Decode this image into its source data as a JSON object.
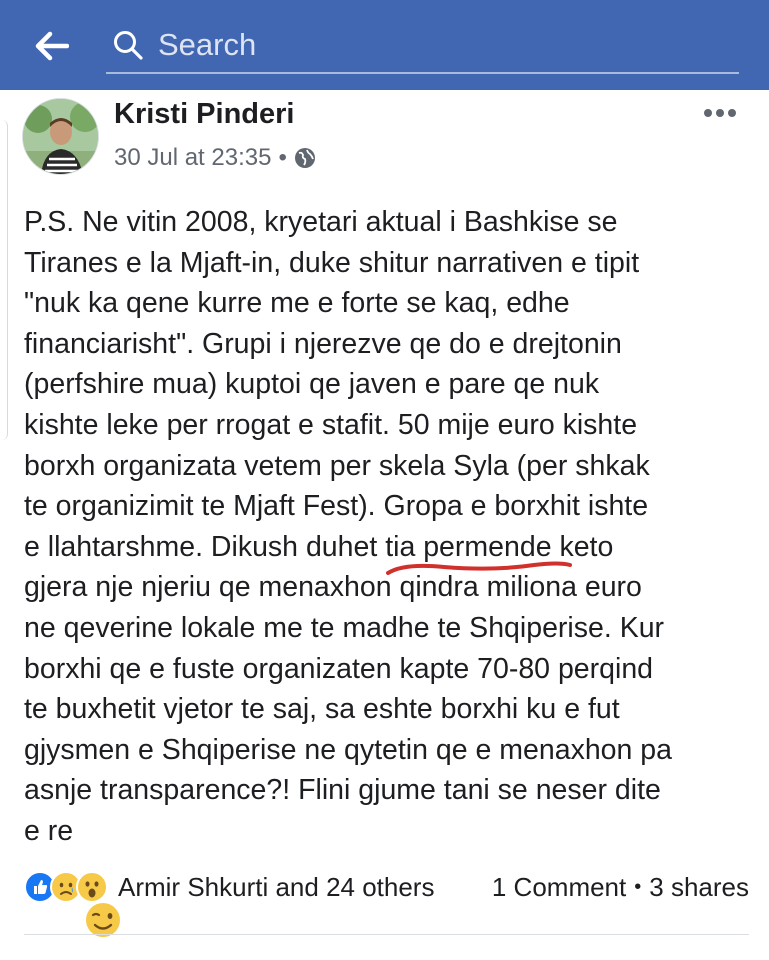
{
  "search": {
    "placeholder": "Search"
  },
  "post": {
    "author": "Kristi Pinderi",
    "timestamp": "30 Jul at 23:35",
    "dot": "•",
    "privacy_icon": "globe-icon",
    "more_icon": "more-dots-icon",
    "text": "P.S. Ne vitin 2008, kryetari aktual i Bashkise se\nTiranes e la Mjaft-in, duke shitur narrativen e tipit\n\"nuk ka qene kurre me e forte se kaq, edhe\nfinanciarisht\". Grupi i njerezve qe do e drejtonin\n(perfshire mua) kuptoi qe javen e pare qe nuk\nkishte leke per rrogat e stafit. 50 mije euro kishte\nborxh organizata vetem per skela Syla (per shkak\nte organizimit te Mjaft Fest). Gropa e borxhit ishte\ne llahtarshme. Dikush duhet tia permende keto\ngjera nje njeriu qe menaxhon qindra miliona euro\nne qeverine lokale me te madhe te Shqiperise. Kur\nborxhi qe e fuste organizaten kapte 70-80 perqind\nte buxhetit vjetor te saj, sa eshte borxhi ku e fut\ngjysmen e Shqiperise ne qytetin qe e menaxhon pa\nasnje transparence?! Flini gjume tani se neser dite\ne re",
    "emoji": "wink-emoji"
  },
  "footer": {
    "reactions": [
      "like-icon",
      "sad-icon",
      "wow-icon"
    ],
    "reactors": "Armir Shkurti and 24 others",
    "comments": "1 Comment",
    "sep": "•",
    "shares": "3 shares"
  },
  "colors": {
    "topbar": "#4267b2",
    "underline": "#d0312d",
    "like": "#1877f2",
    "emoji_yellow": "#f7c948"
  }
}
